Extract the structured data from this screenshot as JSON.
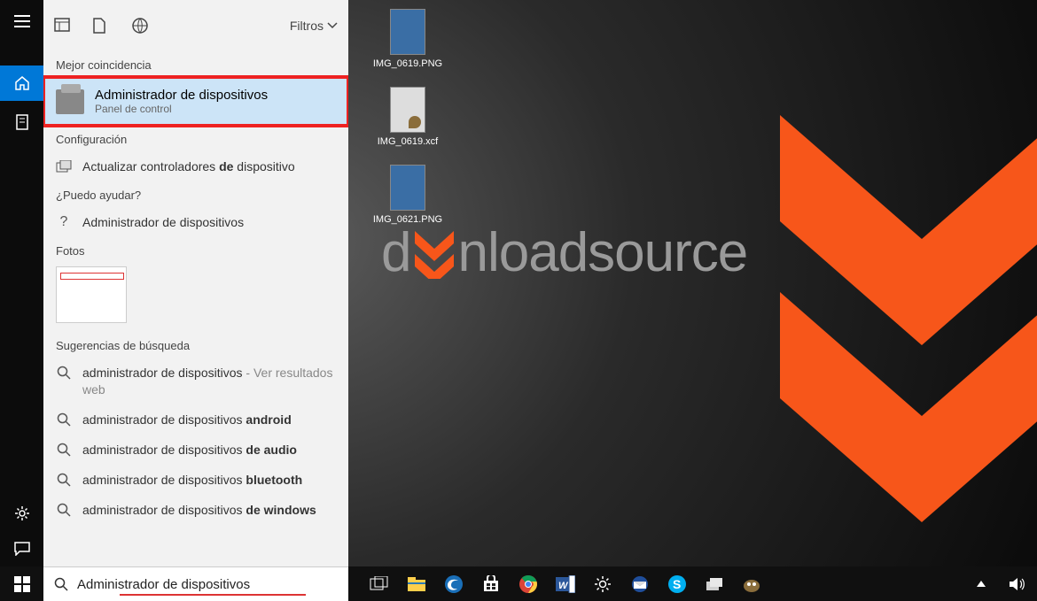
{
  "filters_label": "Filtros",
  "sections": {
    "best_match": "Mejor coincidencia",
    "configuration": "Configuración",
    "help": "¿Puedo ayudar?",
    "photos": "Fotos",
    "suggestions": "Sugerencias de búsqueda"
  },
  "best_match": {
    "title": "Administrador de dispositivos",
    "subtitle": "Panel de control"
  },
  "configuration_item": {
    "prefix": "Actualizar controladores ",
    "bold": "de",
    "suffix": " dispositivo"
  },
  "help_item": "Administrador de dispositivos",
  "suggestions_list": [
    {
      "plain": "administrador de dispositivos",
      "grey": " - Ver resultados web",
      "bold": ""
    },
    {
      "plain": "administrador de dispositivos ",
      "grey": "",
      "bold": "android"
    },
    {
      "plain": "administrador de dispositivos ",
      "grey": "",
      "bold": "de audio"
    },
    {
      "plain": "administrador de dispositivos ",
      "grey": "",
      "bold": "bluetooth"
    },
    {
      "plain": "administrador de dispositivos ",
      "grey": "",
      "bold": "de windows"
    }
  ],
  "search_value": "Administrador de dispositivos",
  "desktop_icons": [
    {
      "label": "IMG_0619.PNG",
      "kind": "png"
    },
    {
      "label": "IMG_0619.xcf",
      "kind": "xcf"
    },
    {
      "label": "IMG_0621.PNG",
      "kind": "png"
    }
  ],
  "watermark": {
    "prefix": "d",
    "rest": "nloadsource"
  },
  "colors": {
    "accent": "#0078d7",
    "highlight_border": "#e22222",
    "orange": "#f7561a"
  }
}
